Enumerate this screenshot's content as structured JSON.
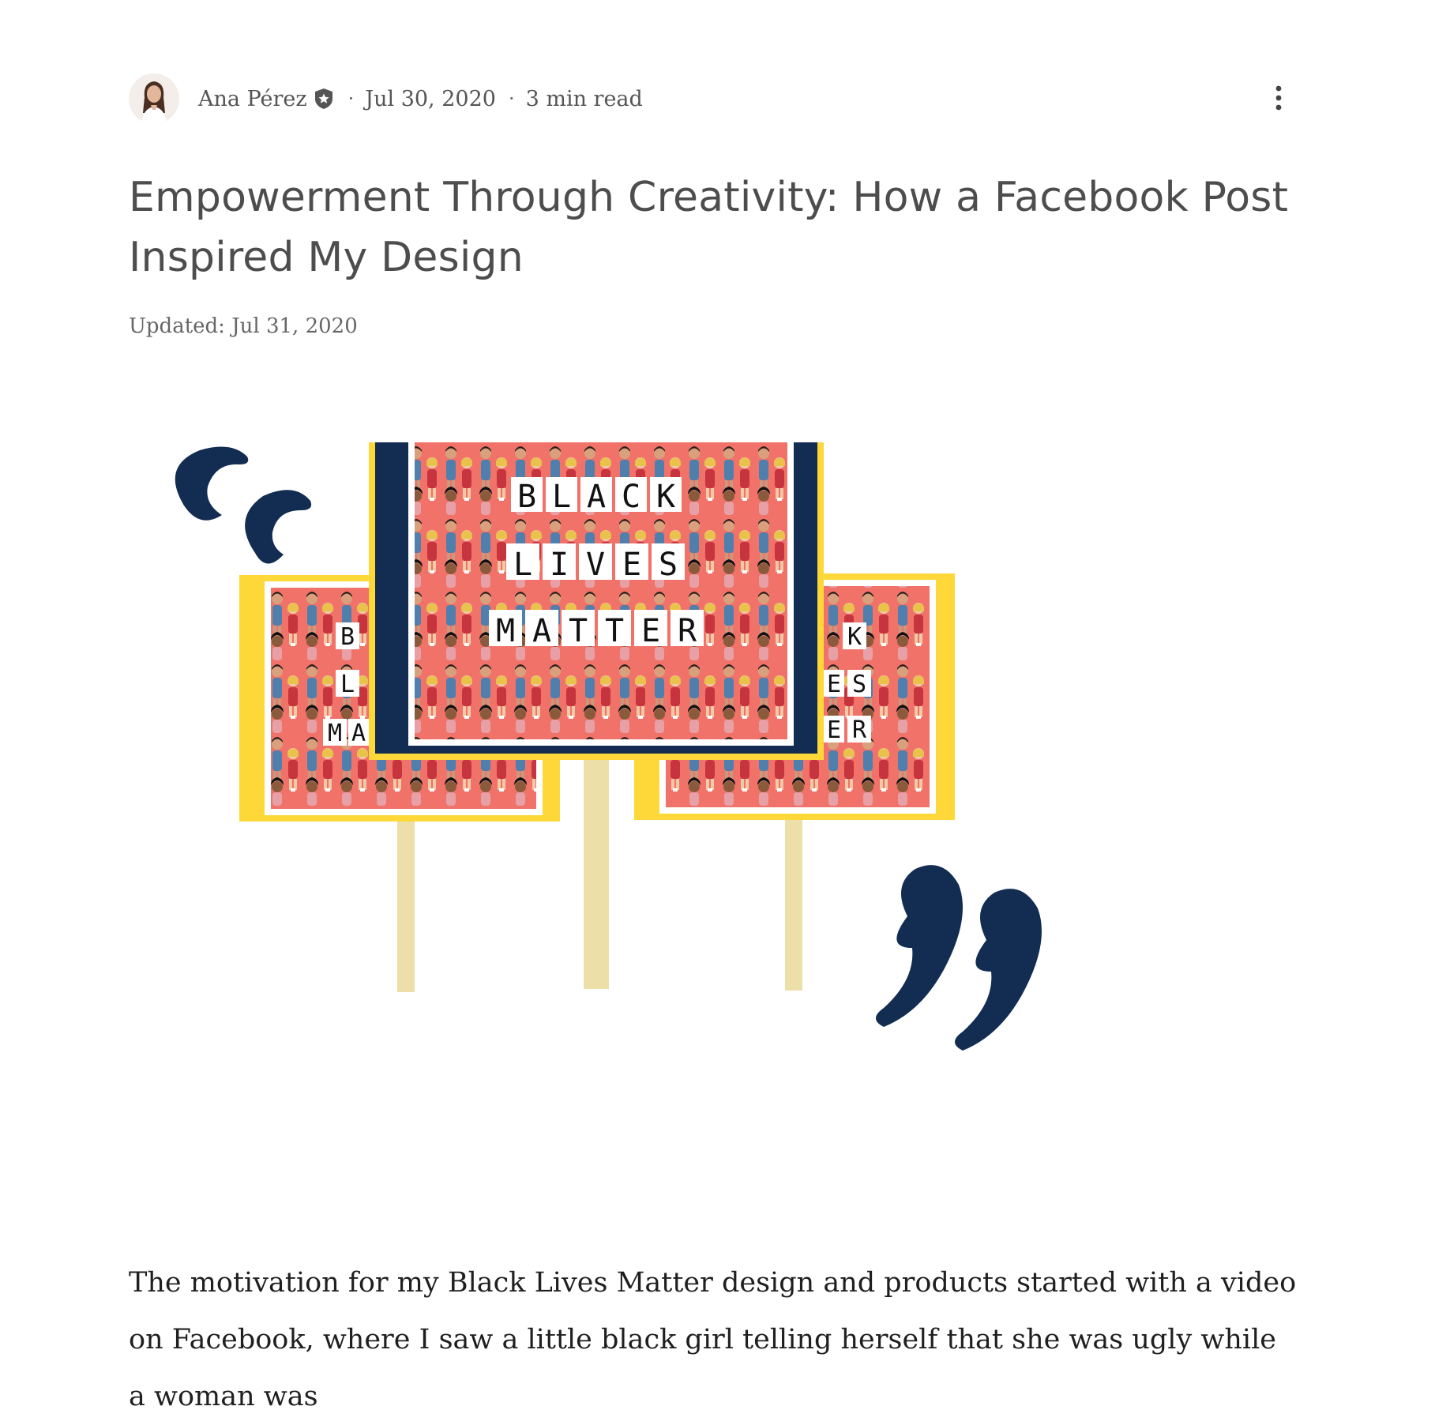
{
  "post": {
    "author": {
      "name": "Ana Pérez",
      "avatar_icon": "author-avatar",
      "badge_icon": "admin-badge-icon"
    },
    "date": "Jul 30, 2020",
    "read_time": "3 min read",
    "separator": "·",
    "more_icon": "more-vertical-icon",
    "title": "Empowerment Through Creativity: How a Facebook Post Inspired My Design",
    "updated": "Updated: Jul 31, 2020",
    "hero": {
      "sign_center_words": [
        "BLACK",
        "LIVES",
        "MATTER"
      ],
      "sign_left_fragments": [
        "B",
        "L",
        "MA"
      ],
      "sign_right_fragments": [
        "K",
        "ES",
        "ER"
      ],
      "colors": {
        "navy": "#122c52",
        "yellow": "#fdd838",
        "coral": "#f07268",
        "pole": "#ece0a8",
        "quote": "#122c52"
      }
    },
    "body_intro": "The motivation for my Black Lives Matter design and products started with a video on Facebook, where I saw a little black girl telling herself that she was ugly while a woman was"
  }
}
